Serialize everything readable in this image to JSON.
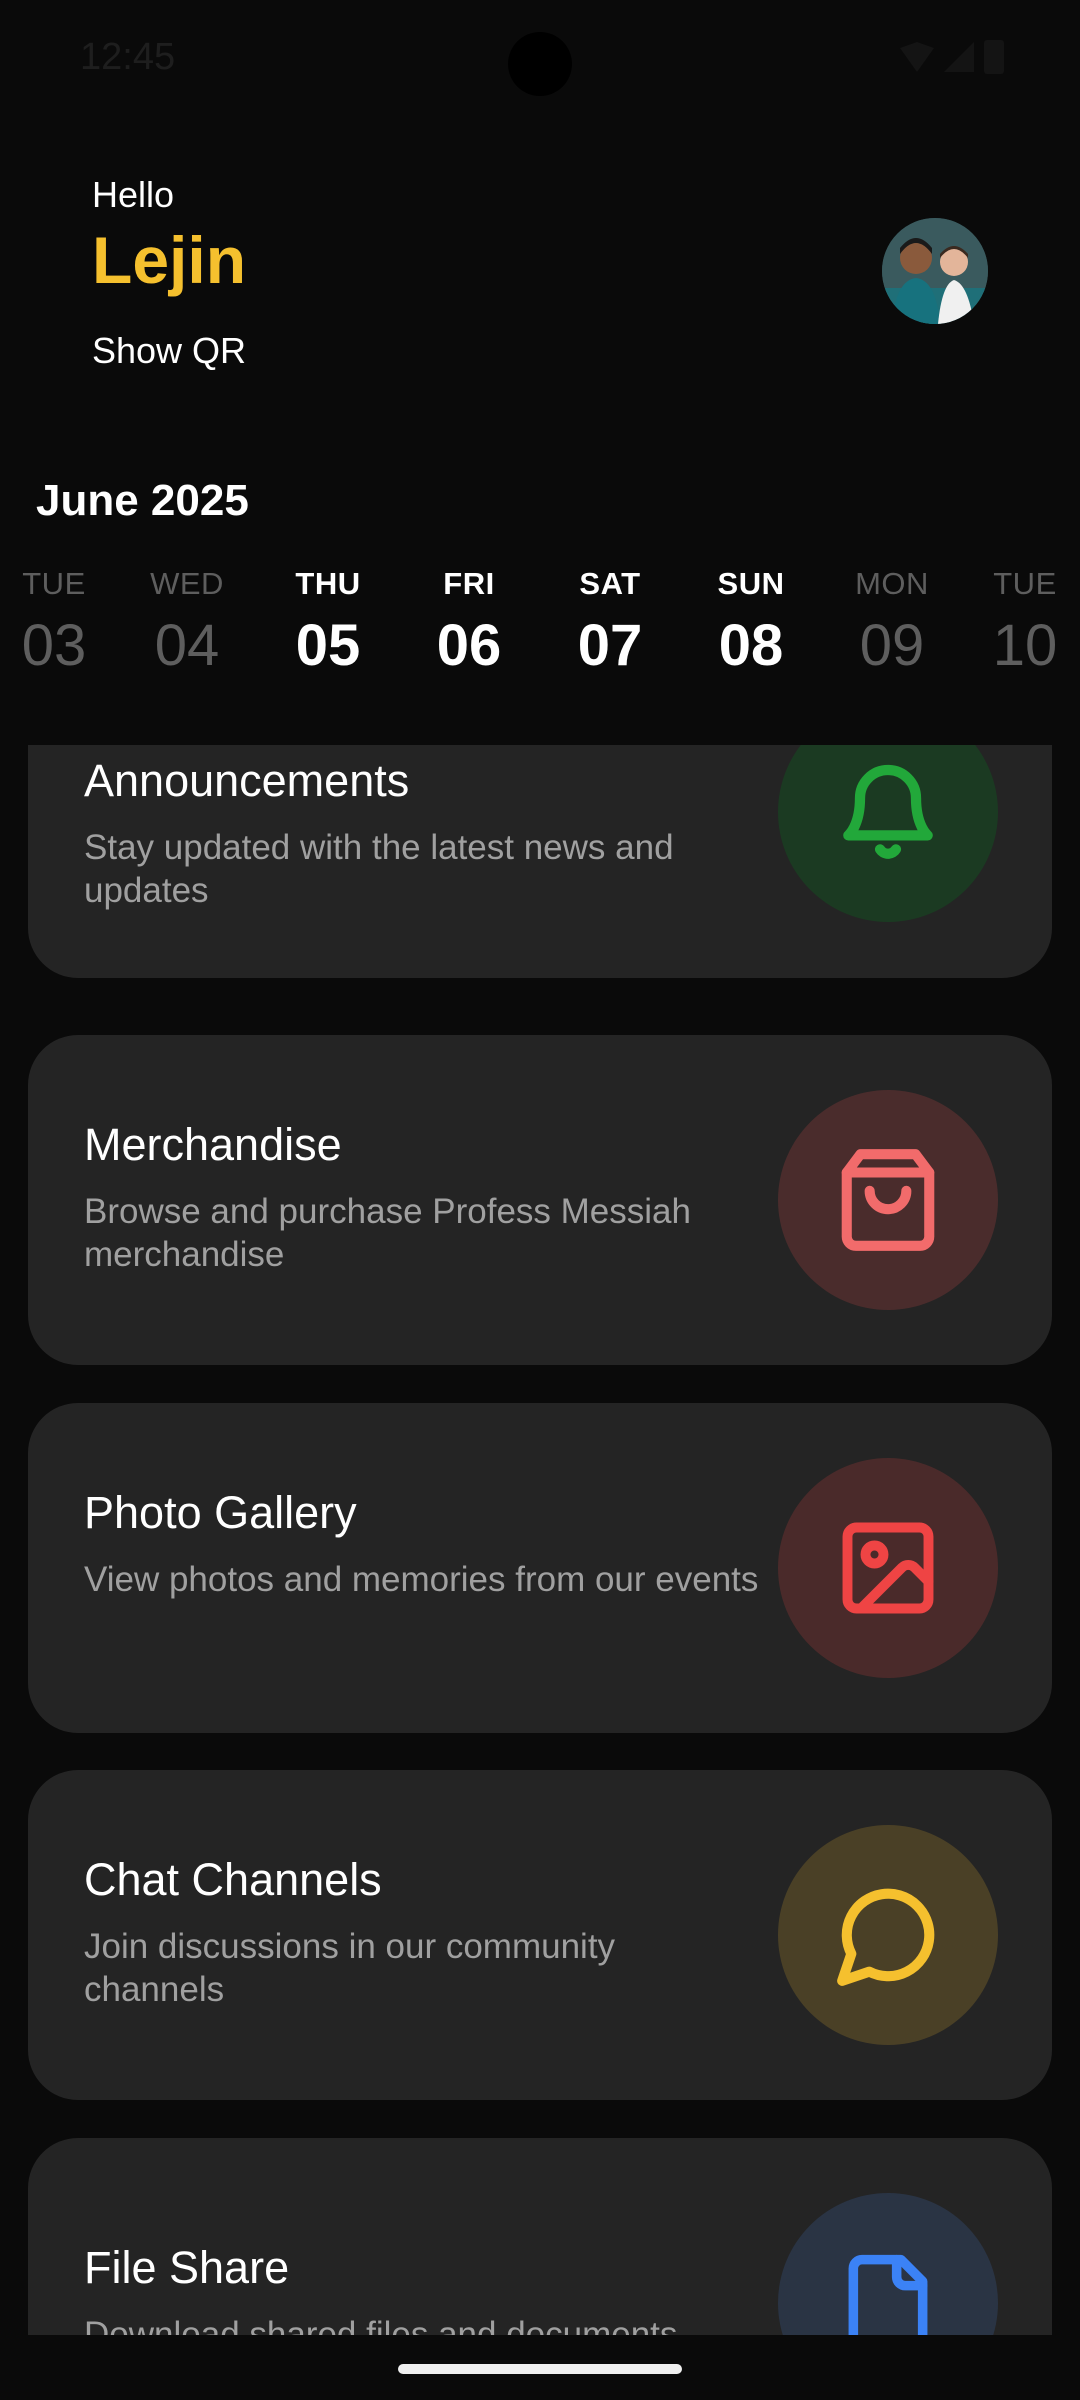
{
  "status_bar": {
    "time": "12:45"
  },
  "header": {
    "greeting": "Hello",
    "user_name": "Lejin",
    "show_qr_label": "Show QR"
  },
  "calendar": {
    "month_label": "June 2025",
    "days": [
      {
        "name": "TUE",
        "num": "03",
        "state": "dim"
      },
      {
        "name": "WED",
        "num": "04",
        "state": "dim"
      },
      {
        "name": "THU",
        "num": "05",
        "state": "active"
      },
      {
        "name": "FRI",
        "num": "06",
        "state": "active"
      },
      {
        "name": "SAT",
        "num": "07",
        "state": "active"
      },
      {
        "name": "SUN",
        "num": "08",
        "state": "active"
      },
      {
        "name": "MON",
        "num": "09",
        "state": "dim"
      },
      {
        "name": "TUE",
        "num": "10",
        "state": "dim"
      }
    ]
  },
  "cards": [
    {
      "title": "Announcements",
      "description": "Stay updated with the latest news and updates",
      "icon": "bell-icon",
      "icon_color": "#22a83a",
      "icon_bg": "#1b3a22"
    },
    {
      "title": "Merchandise",
      "description": "Browse and purchase Profess Messiah merchandise",
      "icon": "shopping-bag-icon",
      "icon_color": "#f26b6b",
      "icon_bg": "#4a2c2c"
    },
    {
      "title": "Photo Gallery",
      "description": "View photos and memories from our events",
      "icon": "image-icon",
      "icon_color": "#ef4444",
      "icon_bg": "#4a2a2a"
    },
    {
      "title": "Chat Channels",
      "description": "Join discussions in our community channels",
      "icon": "chat-bubble-icon",
      "icon_color": "#f5c02e",
      "icon_bg": "#4a4026"
    },
    {
      "title": "File Share",
      "description": "Download shared files and documents",
      "icon": "file-icon",
      "icon_color": "#3b82f6",
      "icon_bg": "#2a3444"
    }
  ]
}
